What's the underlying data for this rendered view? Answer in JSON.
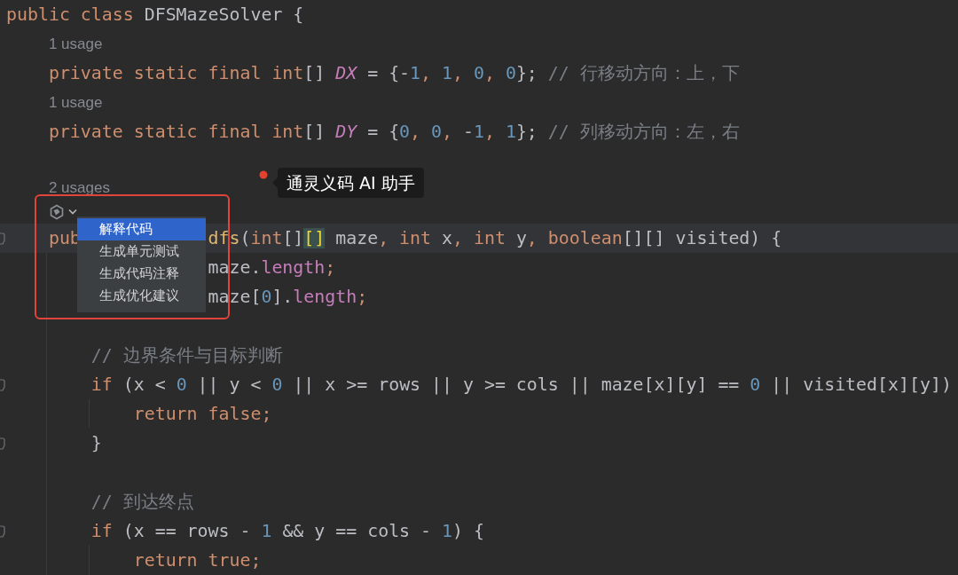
{
  "editor": {
    "lines": [
      {
        "kind": "code",
        "tokens": [
          {
            "t": "public class",
            "kind": "kw"
          },
          {
            "t": " DFSMazeSolver {",
            "kind": "plain"
          }
        ]
      },
      {
        "kind": "usage",
        "text": "1 usage"
      },
      {
        "kind": "code",
        "tokens": [
          {
            "t": "    private static final int",
            "kind": "kw"
          },
          {
            "t": "[] ",
            "kind": "plain"
          },
          {
            "t": "DX",
            "kind": "const"
          },
          {
            "t": " = {-",
            "kind": "plain"
          },
          {
            "t": "1",
            "kind": "num"
          },
          {
            "t": ", ",
            "kind": "kw"
          },
          {
            "t": "1",
            "kind": "num"
          },
          {
            "t": ", ",
            "kind": "kw"
          },
          {
            "t": "0",
            "kind": "num"
          },
          {
            "t": ", ",
            "kind": "kw"
          },
          {
            "t": "0",
            "kind": "num"
          },
          {
            "t": "}; ",
            "kind": "plain"
          },
          {
            "t": "// 行移动方向：上，下",
            "kind": "comment"
          }
        ]
      },
      {
        "kind": "usage",
        "text": "1 usage"
      },
      {
        "kind": "code",
        "tokens": [
          {
            "t": "    private static final int",
            "kind": "kw"
          },
          {
            "t": "[] ",
            "kind": "plain"
          },
          {
            "t": "DY",
            "kind": "const"
          },
          {
            "t": " = {",
            "kind": "plain"
          },
          {
            "t": "0",
            "kind": "num"
          },
          {
            "t": ", ",
            "kind": "kw"
          },
          {
            "t": "0",
            "kind": "num"
          },
          {
            "t": ", ",
            "kind": "kw"
          },
          {
            "t": "-",
            "kind": "plain"
          },
          {
            "t": "1",
            "kind": "num"
          },
          {
            "t": ", ",
            "kind": "kw"
          },
          {
            "t": "1",
            "kind": "num"
          },
          {
            "t": "}; ",
            "kind": "plain"
          },
          {
            "t": "// 列移动方向：左，右",
            "kind": "comment"
          }
        ]
      },
      {
        "kind": "blank"
      },
      {
        "kind": "usage",
        "text": "2 usages"
      },
      {
        "kind": "ai-inlay"
      },
      {
        "kind": "code",
        "current": true,
        "fold": true,
        "tokens": [
          {
            "t": "    pub",
            "kind": "kw"
          },
          {
            "kind": "gap"
          },
          {
            "t": "dfs",
            "kind": "method"
          },
          {
            "t": "(",
            "kind": "plain"
          },
          {
            "t": "int",
            "kind": "kw"
          },
          {
            "t": "[]",
            "kind": "plain"
          },
          {
            "t": "[]",
            "kind": "match"
          },
          {
            "t": " maze",
            "kind": "plain"
          },
          {
            "t": ", int ",
            "kind": "kw"
          },
          {
            "t": "x",
            "kind": "plain"
          },
          {
            "t": ", int ",
            "kind": "kw"
          },
          {
            "t": "y",
            "kind": "plain"
          },
          {
            "t": ", boolean",
            "kind": "kw"
          },
          {
            "t": "[][] visited) {",
            "kind": "plain"
          }
        ]
      },
      {
        "kind": "code",
        "tokens": [
          {
            "kind": "gap"
          },
          {
            "t": "maze.",
            "kind": "plain"
          },
          {
            "t": "length",
            "kind": "field"
          },
          {
            "t": ";",
            "kind": "kw"
          }
        ]
      },
      {
        "kind": "code",
        "tokens": [
          {
            "kind": "gap"
          },
          {
            "t": "maze[",
            "kind": "plain"
          },
          {
            "t": "0",
            "kind": "num"
          },
          {
            "t": "].",
            "kind": "plain"
          },
          {
            "t": "length",
            "kind": "field"
          },
          {
            "t": ";",
            "kind": "kw"
          }
        ]
      },
      {
        "kind": "blank"
      },
      {
        "kind": "code",
        "tokens": [
          {
            "t": "        // 边界条件与目标判断",
            "kind": "comment"
          }
        ]
      },
      {
        "kind": "code",
        "fold": true,
        "tokens": [
          {
            "t": "        if",
            "kind": "kw"
          },
          {
            "t": " (x < ",
            "kind": "plain"
          },
          {
            "t": "0",
            "kind": "num"
          },
          {
            "t": " || y < ",
            "kind": "plain"
          },
          {
            "t": "0",
            "kind": "num"
          },
          {
            "t": " || x >= rows || y >= cols || maze[x][y] == ",
            "kind": "plain"
          },
          {
            "t": "0",
            "kind": "num"
          },
          {
            "t": " || visited[x][y])",
            "kind": "plain"
          }
        ]
      },
      {
        "kind": "code",
        "tokens": [
          {
            "t": "            return false;",
            "kind": "kw"
          }
        ]
      },
      {
        "kind": "code",
        "fold": true,
        "tokens": [
          {
            "t": "        }",
            "kind": "plain"
          }
        ]
      },
      {
        "kind": "blank"
      },
      {
        "kind": "code",
        "tokens": [
          {
            "t": "        // 到达终点",
            "kind": "comment"
          }
        ]
      },
      {
        "kind": "code",
        "fold": true,
        "tokens": [
          {
            "t": "        if",
            "kind": "kw"
          },
          {
            "t": " (x == rows - ",
            "kind": "plain"
          },
          {
            "t": "1",
            "kind": "num"
          },
          {
            "t": " && y == cols - ",
            "kind": "plain"
          },
          {
            "t": "1",
            "kind": "num"
          },
          {
            "t": ") {",
            "kind": "plain"
          }
        ]
      },
      {
        "kind": "code",
        "tokens": [
          {
            "t": "            return true;",
            "kind": "kw"
          }
        ]
      }
    ]
  },
  "ai_tooltip": {
    "text": "通灵义码 AI 助手"
  },
  "ai_menu": {
    "items": [
      {
        "label": "解释代码",
        "selected": true
      },
      {
        "label": "生成单元测试",
        "selected": false
      },
      {
        "label": "生成代码注释",
        "selected": false
      },
      {
        "label": "生成优化建议",
        "selected": false
      }
    ]
  }
}
